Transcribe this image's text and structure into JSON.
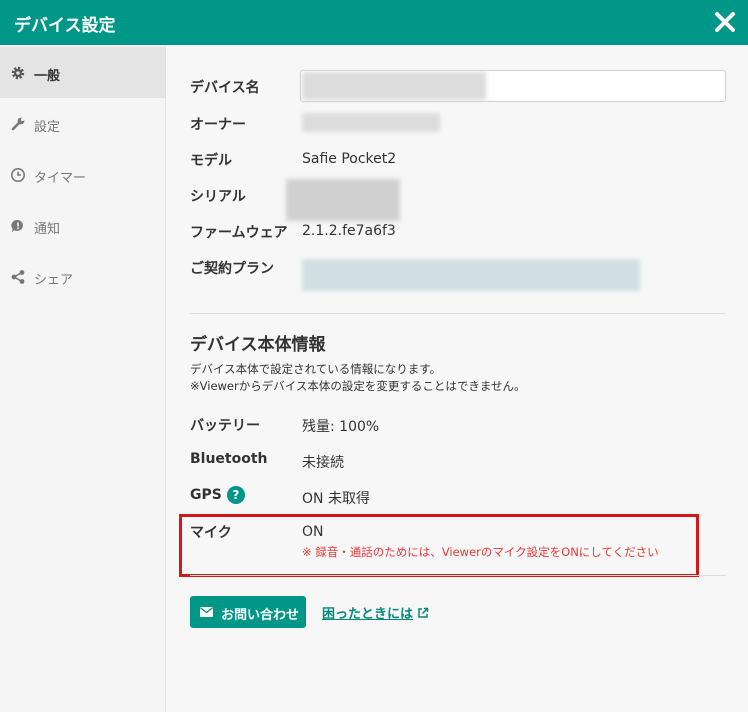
{
  "header": {
    "title": "デバイス設定",
    "close_icon": "close-icon"
  },
  "sidebar": {
    "items": [
      {
        "label": "一般",
        "icon": "gear-icon",
        "active": true
      },
      {
        "label": "設定",
        "icon": "wrench-icon",
        "active": false
      },
      {
        "label": "タイマー",
        "icon": "clock-icon",
        "active": false
      },
      {
        "label": "通知",
        "icon": "notification-icon",
        "active": false
      },
      {
        "label": "シェア",
        "icon": "share-icon",
        "active": false
      }
    ]
  },
  "general": {
    "device_name_label": "デバイス名",
    "owner_label": "オーナー",
    "model_label": "モデル",
    "model_value": "Safie Pocket2",
    "serial_label": "シリアル",
    "firmware_label": "ファームウェア",
    "firmware_value": "2.1.2.fe7a6f3",
    "plan_label": "ご契約プラン"
  },
  "device_info": {
    "title": "デバイス本体情報",
    "desc_line1": "デバイス本体で設定されている情報になります。",
    "desc_line2": "※Viewerからデバイス本体の設定を変更することはできません。",
    "battery_label": "バッテリー",
    "battery_value": "残量: 100%",
    "bluetooth_label": "Bluetooth",
    "bluetooth_value": "未接続",
    "gps_label": "GPS",
    "gps_value": "ON 未取得",
    "mic_label": "マイク",
    "mic_value": "ON",
    "mic_note": "※ 録音・通話のためには、Viewerのマイク設定をONにしてください"
  },
  "footer": {
    "contact_label": "お問い合わせ",
    "help_link": "困ったときには"
  },
  "colors": {
    "header": "#009688",
    "accent": "#009688",
    "warning": "#e53935",
    "highlight_box": "#d21919"
  }
}
